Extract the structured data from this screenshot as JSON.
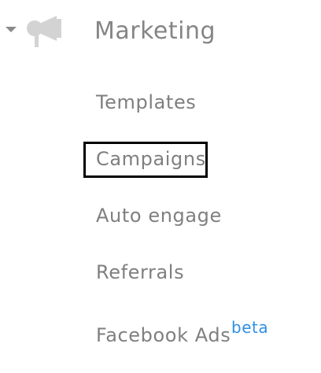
{
  "section": {
    "title": "Marketing",
    "icon": "megaphone-icon",
    "expanded_indicator": "caret-down-icon"
  },
  "items": [
    {
      "label": "Templates"
    },
    {
      "label": "Campaigns",
      "highlighted": true
    },
    {
      "label": "Auto engage"
    },
    {
      "label": "Referrals"
    },
    {
      "label": "Facebook Ads",
      "badge": "beta"
    }
  ],
  "colors": {
    "text": "#7f7f7f",
    "title": "#858585",
    "icon": "#d3d3d3",
    "badge": "#2f8fe6",
    "highlight_border": "#000000"
  }
}
